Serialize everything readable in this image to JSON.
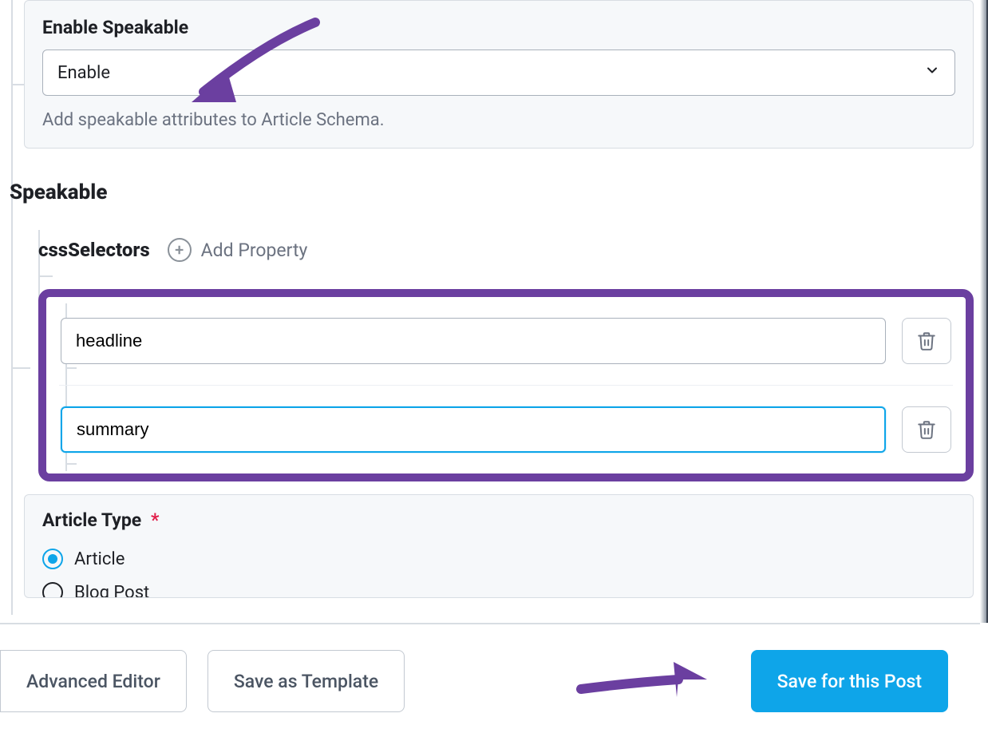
{
  "annotation_color": "#6b3fa0",
  "enable_speakable": {
    "label": "Enable Speakable",
    "value": "Enable",
    "hint": "Add speakable attributes to Article Schema."
  },
  "speakable": {
    "title": "Speakable",
    "css_selectors": {
      "label": "cssSelectors",
      "add_property_label": "Add Property",
      "items": [
        {
          "value": "headline",
          "focused": false
        },
        {
          "value": "summary",
          "focused": true
        }
      ]
    }
  },
  "article_type": {
    "label": "Article Type",
    "required_mark": "*",
    "options": [
      {
        "label": "Article",
        "selected": true
      },
      {
        "label": "Blog Post",
        "selected": false
      }
    ]
  },
  "footer": {
    "advanced_editor": "Advanced Editor",
    "save_template": "Save as Template",
    "save_post": "Save for this Post"
  }
}
